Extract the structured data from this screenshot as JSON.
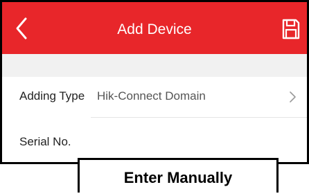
{
  "header": {
    "title": "Add Device",
    "background_color": "#e8262a",
    "back_icon": "chevron-left-icon",
    "save_icon": "save-icon"
  },
  "form": {
    "adding_type": {
      "label": "Adding Type",
      "value": "Hik-Connect Domain",
      "icon": "chevron-right-icon"
    },
    "serial": {
      "label": "Serial No."
    }
  },
  "caption": {
    "text": "Enter Manually"
  }
}
